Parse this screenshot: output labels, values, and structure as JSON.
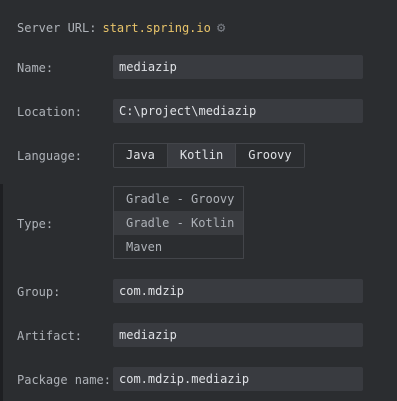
{
  "server": {
    "label": "Server URL:",
    "url": "start.spring.io",
    "settings_icon": "gear-icon"
  },
  "fields": {
    "name": {
      "label": "Name:",
      "value": "mediazip"
    },
    "location": {
      "label": "Location:",
      "value": "C:\\project\\mediazip"
    },
    "group": {
      "label": "Group:",
      "value": "com.mdzip"
    },
    "artifact": {
      "label": "Artifact:",
      "value": "mediazip"
    },
    "package_name": {
      "label": "Package name:",
      "value": "com.mdzip.mediazip"
    }
  },
  "language": {
    "label": "Language:",
    "options": [
      "Java",
      "Kotlin",
      "Groovy"
    ],
    "selected": "Kotlin"
  },
  "type": {
    "label": "Type:",
    "options": [
      "Gradle - Groovy",
      "Gradle - Kotlin",
      "Maven"
    ],
    "selected": "Gradle - Kotlin"
  }
}
